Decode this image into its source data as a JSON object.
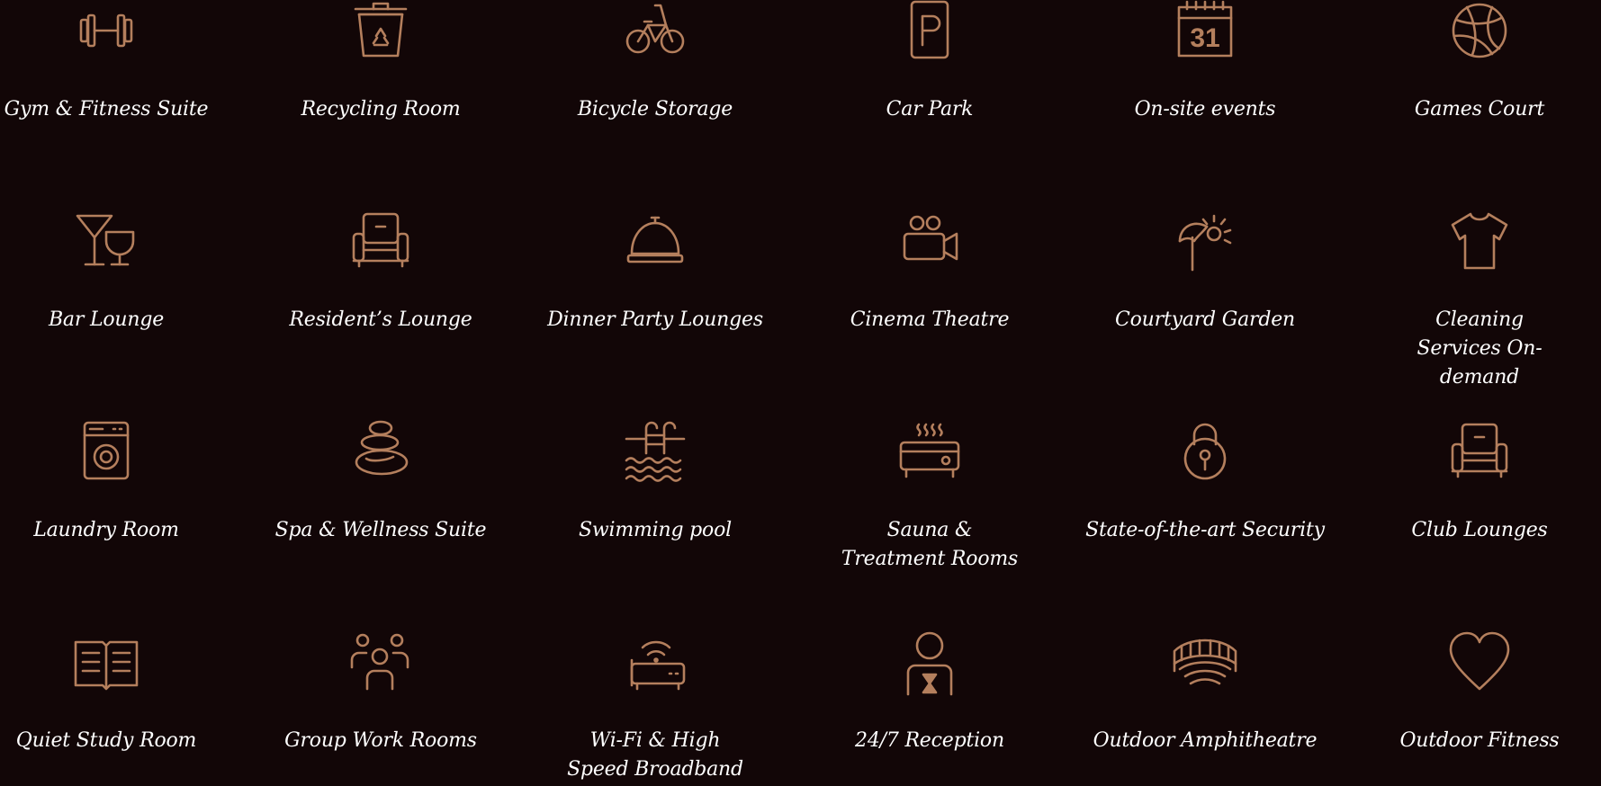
{
  "amenities": [
    {
      "label": "Gym & Fitness Suite",
      "icon": "dumbbell-icon"
    },
    {
      "label": "Recycling Room",
      "icon": "recycling-bin-icon"
    },
    {
      "label": "Bicycle Storage",
      "icon": "bicycle-icon"
    },
    {
      "label": "Car Park",
      "icon": "parking-icon"
    },
    {
      "label": "On-site events",
      "icon": "calendar-icon",
      "icon_text": "31"
    },
    {
      "label": "Games Court",
      "icon": "basketball-icon"
    },
    {
      "label": "Bar Lounge",
      "icon": "cocktail-glasses-icon"
    },
    {
      "label": "Resident’s Lounge",
      "icon": "armchair-icon"
    },
    {
      "label": "Dinner Party Lounges",
      "icon": "serving-cloche-icon"
    },
    {
      "label": "Cinema Theatre",
      "icon": "movie-camera-icon"
    },
    {
      "label": "Courtyard Garden",
      "icon": "parasol-sun-icon"
    },
    {
      "label": "Cleaning Services On-demand",
      "icon": "t-shirt-icon"
    },
    {
      "label": "Laundry Room",
      "icon": "washing-machine-icon"
    },
    {
      "label": "Spa & Wellness Suite",
      "icon": "spa-stones-icon"
    },
    {
      "label": "Swimming pool",
      "icon": "pool-ladder-icon"
    },
    {
      "label": "Sauna & Treatment Rooms",
      "icon": "sauna-heater-icon"
    },
    {
      "label": "State-of-the-art Security",
      "icon": "padlock-icon"
    },
    {
      "label": "Club Lounges",
      "icon": "armchair-icon"
    },
    {
      "label": "Quiet Study Room",
      "icon": "open-book-icon"
    },
    {
      "label": "Group Work Rooms",
      "icon": "group-people-icon"
    },
    {
      "label": "Wi-Fi & High Speed Broadband",
      "icon": "wifi-router-icon"
    },
    {
      "label": "24/7 Reception",
      "icon": "receptionist-icon"
    },
    {
      "label": "Outdoor Amphitheatre",
      "icon": "amphitheatre-icon"
    },
    {
      "label": "Outdoor Fitness",
      "icon": "heart-icon"
    }
  ],
  "colors": {
    "background": "#120607",
    "icon": "#b47f5d",
    "text": "#ffffff"
  }
}
